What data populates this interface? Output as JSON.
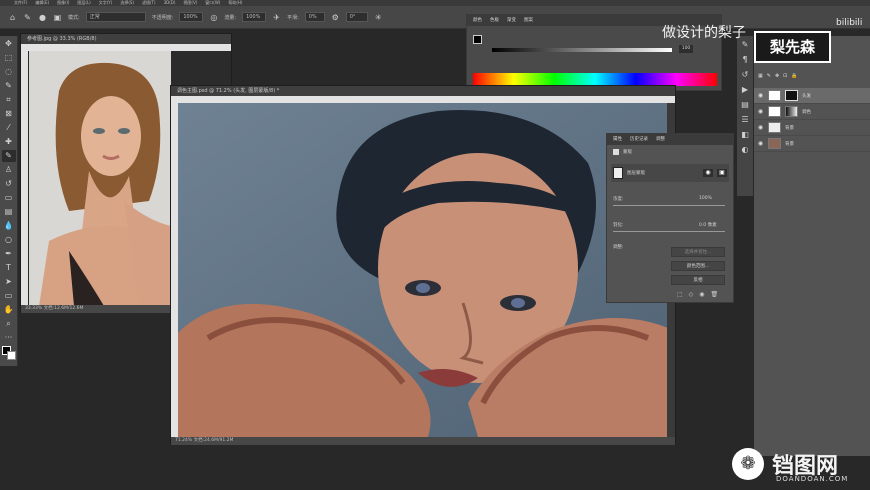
{
  "menu": [
    "文件(F)",
    "编辑(E)",
    "图像(I)",
    "图层(L)",
    "文字(Y)",
    "选择(S)",
    "滤镜(T)",
    "3D(D)",
    "视图(V)",
    "窗口(W)",
    "帮助(H)"
  ],
  "options": {
    "mode_label": "模式:",
    "mode_value": "正常",
    "opacity_label": "不透明度:",
    "opacity_value": "100%",
    "flow_label": "流量:",
    "flow_value": "100%",
    "smooth_label": "平滑:",
    "smooth_value": "0%",
    "angle_value": "0°"
  },
  "doc_small": {
    "tab": "参考图.jpg @ 33.3% (RGB/8)",
    "status": "33.33%  文档:12.6M/12.6M"
  },
  "doc_main": {
    "tab": "调色主图.psd @ 71.2% (头发, 图层蒙版/8) *",
    "status": "71.24%  文档:24.6M/91.2M"
  },
  "color_panel": {
    "tabs": [
      "颜色",
      "色板",
      "渐变",
      "图案"
    ],
    "slider_value": "100"
  },
  "properties_panel": {
    "tabs": [
      "属性",
      "历史记录",
      "调整"
    ],
    "section_label": "蒙版",
    "layer_mask_label": "图层蒙版",
    "density_label": "浓度:",
    "density_value": "100%",
    "feather_label": "羽化:",
    "feather_value": "0.0 像素",
    "adjust_label": "调整:",
    "btn_select_mask": "选择并遮住...",
    "btn_color_range": "颜色范围...",
    "btn_invert": "反相"
  },
  "layers_panel": {
    "layers": [
      {
        "name": "头发",
        "thumb": "mask"
      },
      {
        "name": "调色",
        "thumb": "mask2"
      },
      {
        "name": "背景",
        "thumb": "light"
      },
      {
        "name": "背景",
        "thumb": "photo"
      }
    ]
  },
  "watermark_top": {
    "text": "做设计的梨子",
    "logo": "梨先森",
    "site": "bilibili"
  },
  "watermark_bottom": {
    "text": "铛图网",
    "url": "DOANDOAN.COM"
  }
}
